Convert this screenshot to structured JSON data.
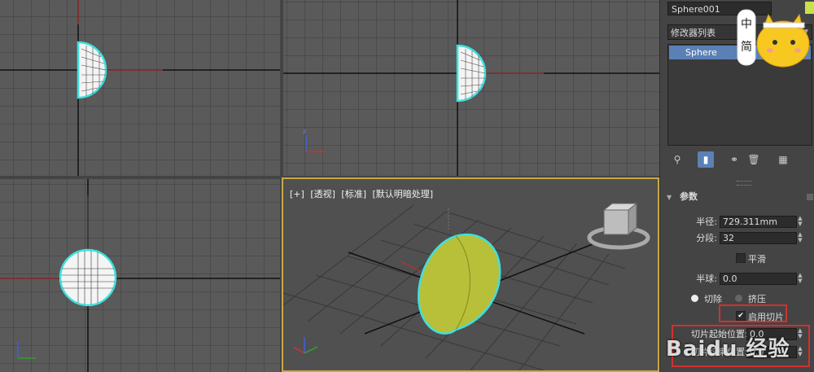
{
  "viewports": {
    "perspective": {
      "labels": [
        "[+]",
        "[透视]",
        "[标准]",
        "[默认明暗处理]"
      ]
    }
  },
  "panel": {
    "object_name": "Sphere001",
    "swatch_color": "#c8e04a",
    "modifier_list": "修改器列表",
    "stack_item": "Sphere",
    "rollout_title": "参数",
    "params": {
      "radius_label": "半径:",
      "radius_value": "729.311mm",
      "segments_label": "分段:",
      "segments_value": "32",
      "smooth_label": "平滑",
      "hemisphere_label": "半球:",
      "hemisphere_value": "0.0",
      "chop_label": "切除",
      "squash_label": "挤压",
      "slice_on_label": "启用切片",
      "slice_from_label": "切片起始位置:",
      "slice_from_value": "0.0",
      "slice_to_label": "切片结束位置:",
      "slice_to_value": "0.0"
    }
  },
  "watermark": "Baidu 经验",
  "mascot": {
    "text_1": "中",
    "text_2": "简"
  },
  "colors": {
    "selection_outline": "#3fe0e0",
    "object_fill": "#b8c03a",
    "highlight_box": "#d23030",
    "active_viewport": "#c8a84a"
  }
}
